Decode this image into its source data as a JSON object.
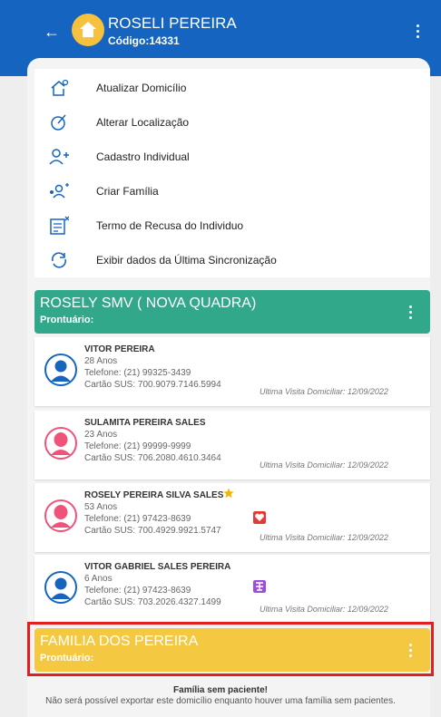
{
  "header": {
    "title": "ROSELI PEREIRA",
    "code": "Código:14331"
  },
  "menu": [
    {
      "label": "Atualizar Domicílio",
      "icon": "house-settings-icon"
    },
    {
      "label": "Alterar Localização",
      "icon": "location-edit-icon"
    },
    {
      "label": "Cadastro Individual",
      "icon": "person-add-icon"
    },
    {
      "label": "Criar Família",
      "icon": "family-add-icon"
    },
    {
      "label": "Termo de Recusa do Individuo",
      "icon": "refusal-document-icon"
    },
    {
      "label": "Exibir dados da Última Sincronização",
      "icon": "sync-icon"
    }
  ],
  "families": [
    {
      "name": "ROSELY SMV ( NOVA QUADRA)",
      "record_label": "Prontuário:",
      "color": "#30a889"
    },
    {
      "name": "FAMILIA DOS PEREIRA",
      "record_label": "Prontuário:",
      "color": "#f5c842"
    }
  ],
  "people": [
    {
      "name": "VITOR PEREIRA",
      "age": "28 Anos",
      "phone": "Telefone: (21) 99325-3439",
      "sus": "Cartão SUS: 700.9079.7146.5994",
      "last_visit": "Ultima Visita Domiciliar: 12/09/2022",
      "gender_color": "#1565c0"
    },
    {
      "name": "SULAMITA PEREIRA SALES",
      "age": "23 Anos",
      "phone": "Telefone: (21) 99999-9999",
      "sus": "Cartão SUS: 706.2080.4610.3464",
      "last_visit": "Ultima Visita Domiciliar: 12/09/2022",
      "gender_color": "#f0527a"
    },
    {
      "name": "ROSELY PEREIRA SILVA SALES",
      "age": "53 Anos",
      "phone": "Telefone: (21) 97423-8639",
      "sus": "Cartão SUS: 700.4929.9921.5747",
      "last_visit": "Ultima Visita Domiciliar: 12/09/2022",
      "gender_color": "#f0527a"
    },
    {
      "name": "VITOR GABRIEL SALES PEREIRA",
      "age": "6 Anos",
      "phone": "Telefone: (21) 97423-8639",
      "sus": "Cartão SUS: 703.2026.4327.1499",
      "last_visit": "Ultima Visita Domiciliar: 12/09/2022",
      "gender_color": "#1565c0"
    }
  ],
  "warning": {
    "title": "Família sem paciente!",
    "message": "Não será possível exportar este domicílio enquanto houver uma família sem pacientes."
  }
}
